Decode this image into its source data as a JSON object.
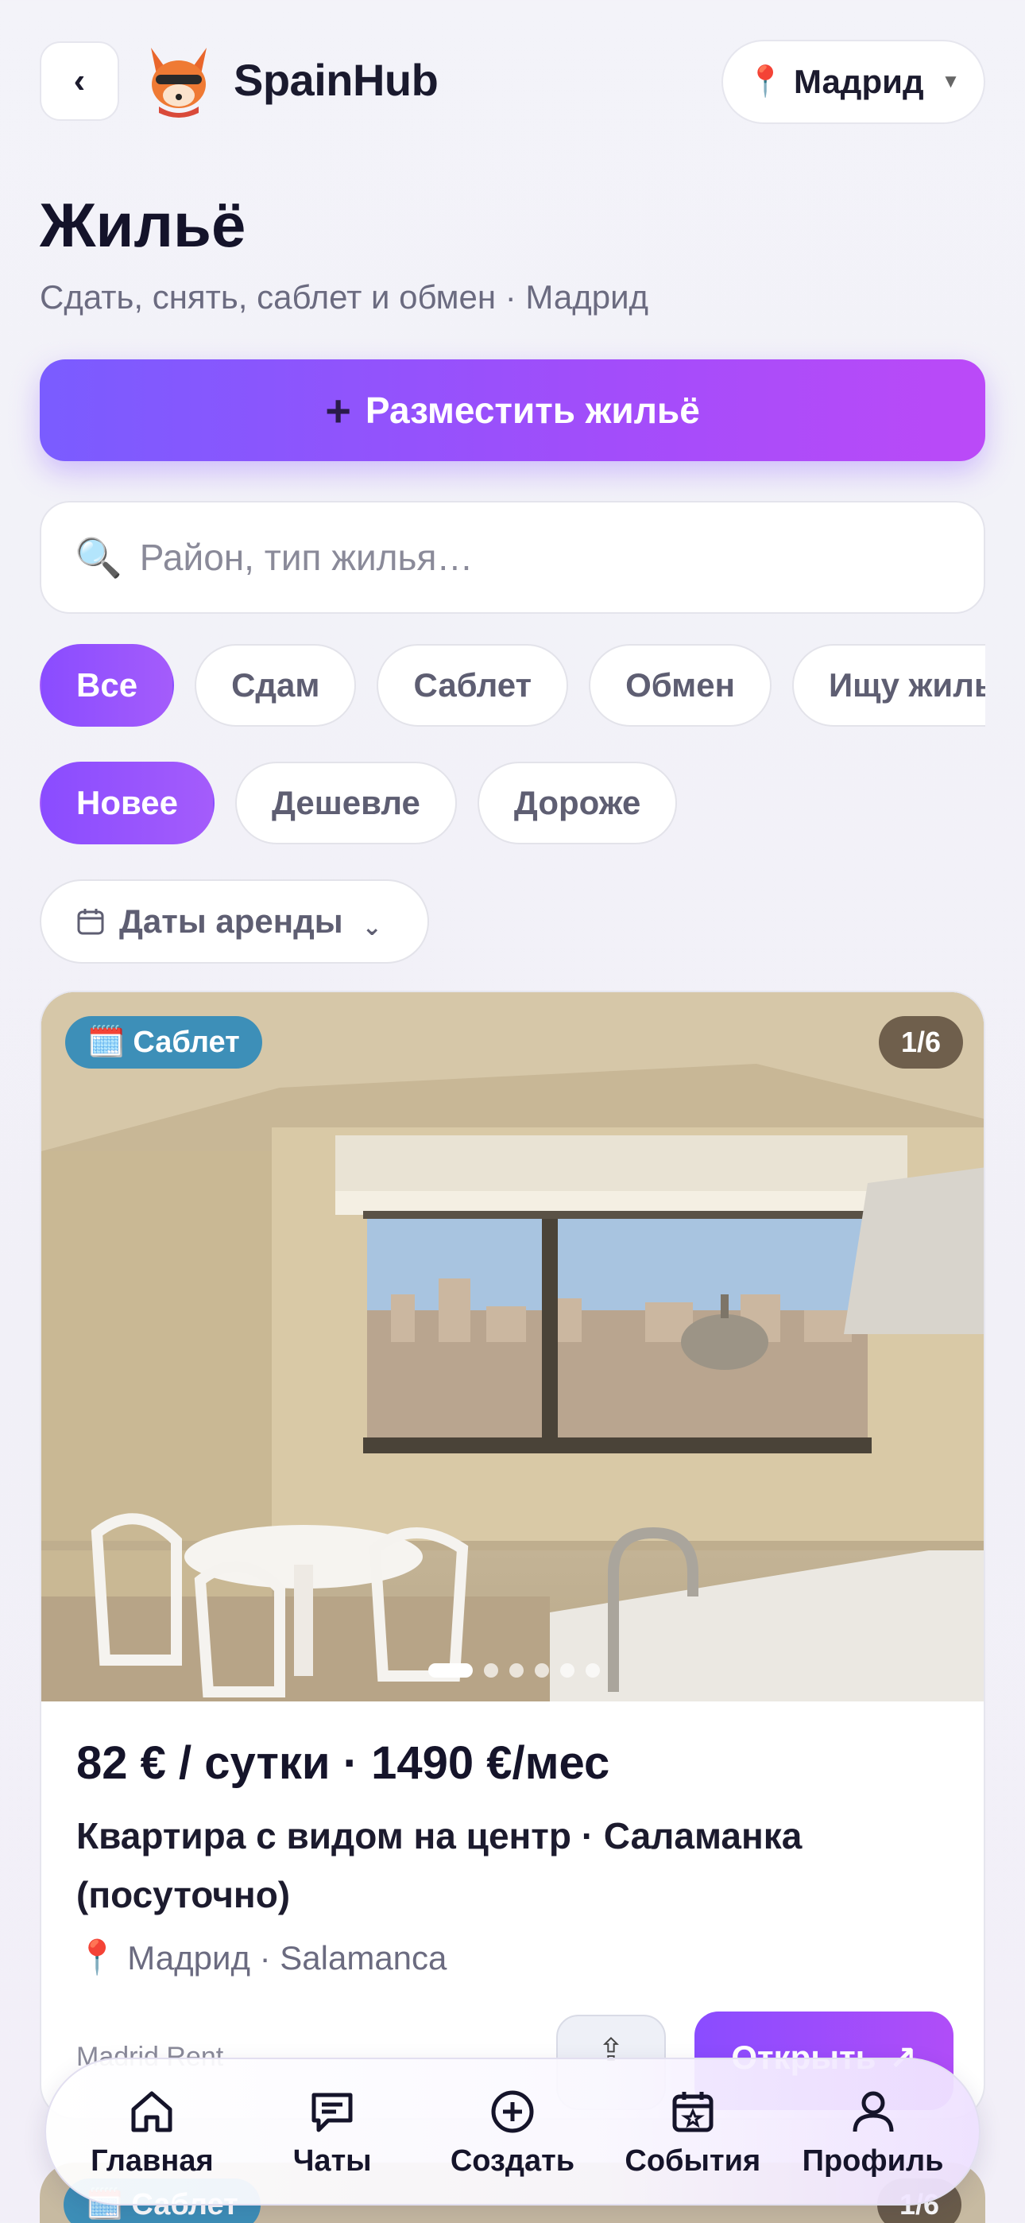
{
  "header": {
    "back_label": "‹",
    "brand": "SpainHub",
    "city": "Мадрид"
  },
  "page": {
    "title": "Жильё",
    "subtitle": "Сдать, снять, саблет и обмен · Мадрид"
  },
  "cta": {
    "label": "Разместить жильё",
    "icon": "+"
  },
  "search": {
    "placeholder": "Район, тип жилья…"
  },
  "filters": {
    "type_chips": [
      "Все",
      "Сдам",
      "Саблет",
      "Обмен",
      "Ищу жилье"
    ],
    "type_selected": "Все",
    "sort_chips": [
      "Новее",
      "Дешевле",
      "Дороже"
    ],
    "sort_selected": "Новее",
    "dates_label": "Даты аренды"
  },
  "listing": {
    "badge": "Саблет",
    "photo_counter": "1/6",
    "photo_count": 6,
    "photo_index": 1,
    "price": "82 € / сутки · 1490 €/мес",
    "title": "Квартира с видом на центр · Саламанка (посуточно)",
    "location": "Мадрид · Salamanca",
    "source": "Madrid Rent",
    "open_label": "Открыть"
  },
  "listing2": {
    "badge": "Саблет",
    "photo_counter": "1/6"
  },
  "nav": {
    "items": [
      {
        "label": "Главная",
        "icon": "home-icon"
      },
      {
        "label": "Чаты",
        "icon": "chat-icon"
      },
      {
        "label": "Создать",
        "icon": "plus-circle-icon"
      },
      {
        "label": "События",
        "icon": "calendar-star-icon"
      },
      {
        "label": "Профиль",
        "icon": "user-icon"
      }
    ]
  },
  "colors": {
    "accent": "#8a4cff",
    "badge": "#3d8fb8"
  }
}
